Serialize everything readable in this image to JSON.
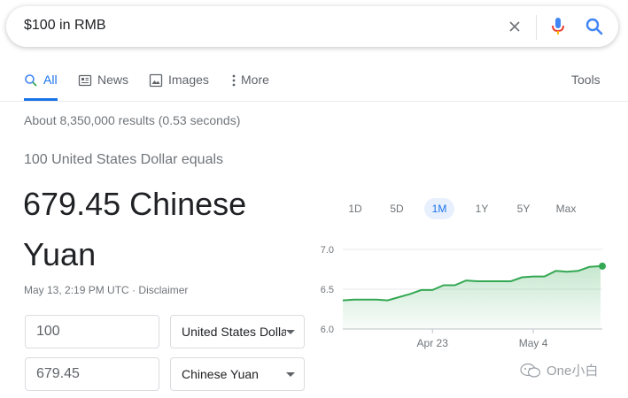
{
  "search": {
    "query": "$100 in RMB"
  },
  "tabs": [
    {
      "label": "All",
      "icon": "search-icon"
    },
    {
      "label": "News",
      "icon": "news-icon"
    },
    {
      "label": "Images",
      "icon": "image-icon"
    },
    {
      "label": "More",
      "icon": "more-vert-icon"
    }
  ],
  "tools_label": "Tools",
  "result_stats": "About 8,350,000 results (0.53 seconds)",
  "converter": {
    "equals_text": "100 United States Dollar equals",
    "result_text": "679.45 Chinese Yuan",
    "timestamp": "May 13, 2:19 PM UTC",
    "separator": "·",
    "disclaimer": "Disclaimer",
    "from_amount": "100",
    "to_amount": "679.45",
    "from_currency": "United States Dollar",
    "to_currency": "Chinese Yuan"
  },
  "ranges": [
    "1D",
    "5D",
    "1M",
    "1Y",
    "5Y",
    "Max"
  ],
  "active_range": "1M",
  "chart_data": {
    "type": "area",
    "title": "",
    "xlabel": "",
    "ylabel": "",
    "x_tick_labels": [
      "Apr 23",
      "May 4"
    ],
    "y_tick_labels": [
      "7.0",
      "6.5",
      "6.0"
    ],
    "ylim": [
      6.0,
      7.0
    ],
    "grid": true,
    "values": [
      6.36,
      6.37,
      6.37,
      6.37,
      6.36,
      6.4,
      6.44,
      6.49,
      6.49,
      6.55,
      6.55,
      6.61,
      6.6,
      6.6,
      6.6,
      6.6,
      6.65,
      6.66,
      6.66,
      6.73,
      6.72,
      6.73,
      6.78,
      6.79
    ],
    "tick_positions": [
      8,
      17
    ],
    "color": "#34a853"
  },
  "watermark": {
    "text": "One小白"
  }
}
